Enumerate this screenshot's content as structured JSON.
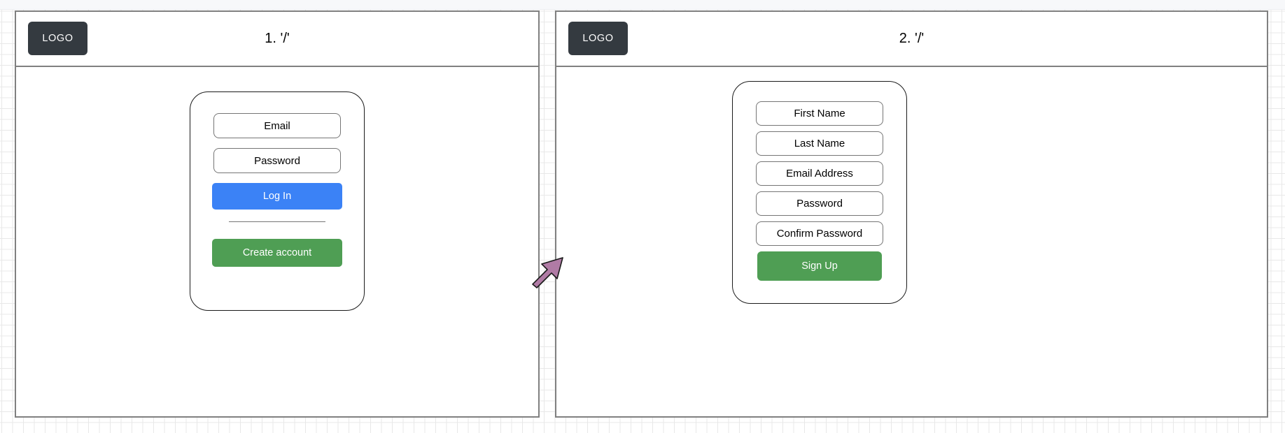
{
  "canvas": {
    "background_color": "#ffffff",
    "grid_minor_color": "#e8e8e8",
    "grid_major_color": "#c9c9c9"
  },
  "frames": [
    {
      "title": "1. '/'",
      "logo_label": "LOGO",
      "logo_color": "#343a40",
      "card": {
        "name": "login-card",
        "fields": [
          {
            "label": "Email"
          },
          {
            "label": "Password"
          }
        ],
        "primary_button": {
          "label": "Log In",
          "color": "#3b82f6"
        },
        "has_divider": true,
        "secondary_button": {
          "label": "Create account",
          "color": "#4f9e54"
        }
      }
    },
    {
      "title": "2. '/'",
      "logo_label": "LOGO",
      "logo_color": "#343a40",
      "card": {
        "name": "signup-card",
        "fields": [
          {
            "label": "First Name"
          },
          {
            "label": "Last Name"
          },
          {
            "label": "Email Address"
          },
          {
            "label": "Password"
          },
          {
            "label": "Confirm Password"
          }
        ],
        "primary_button": {
          "label": "Sign Up",
          "color": "#4f9e54"
        },
        "has_divider": false
      }
    }
  ],
  "connector": {
    "kind": "block-arrow",
    "direction": "up-right",
    "fill_color": "#b07ba5",
    "stroke_color": "#1a1a1a",
    "from_frame": 1,
    "to_frame": 2
  }
}
